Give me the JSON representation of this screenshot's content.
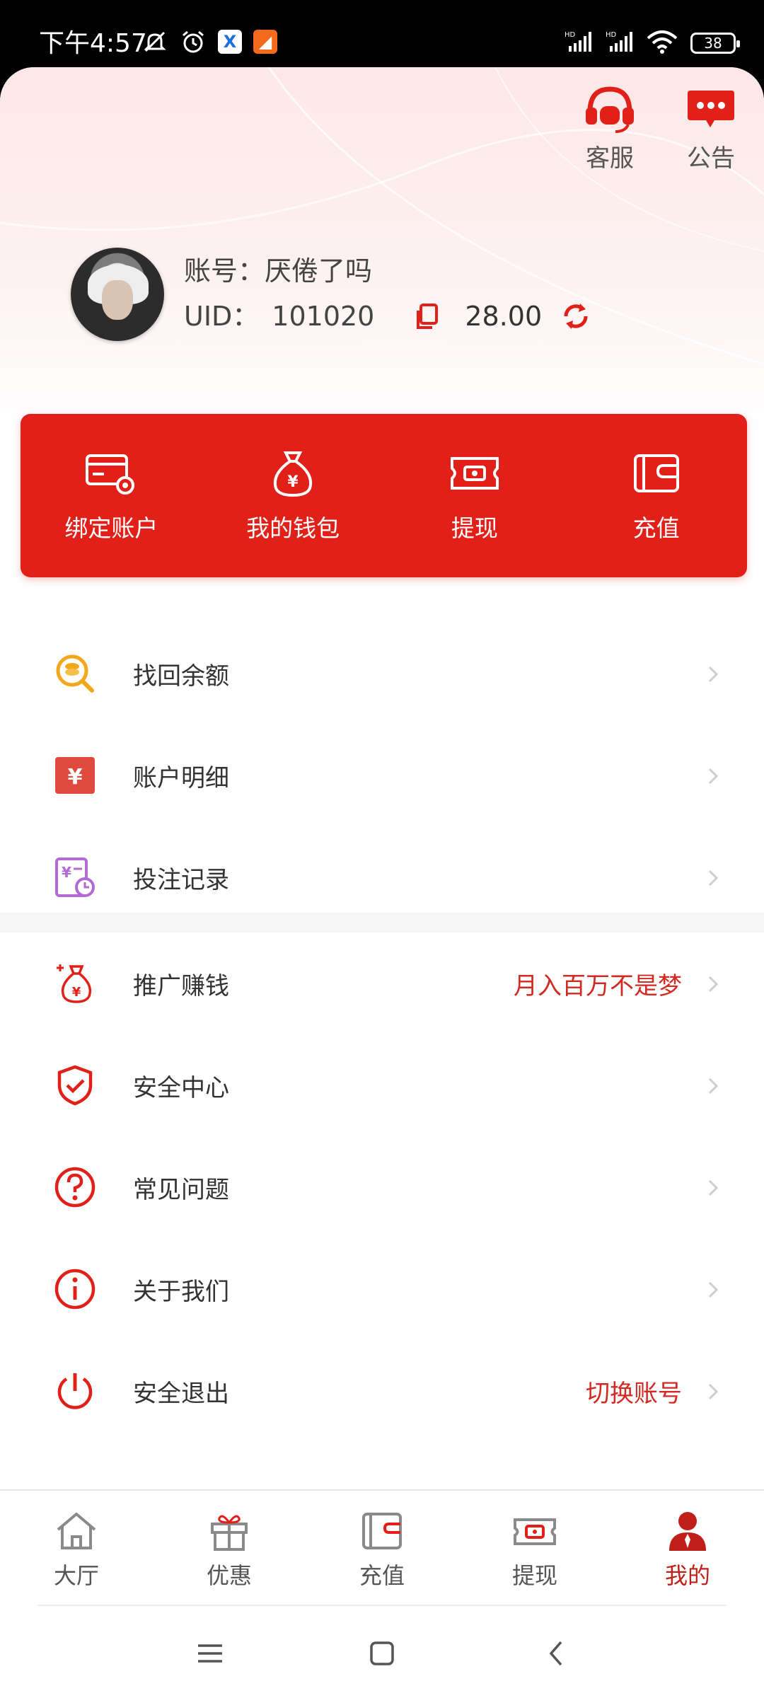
{
  "status_bar": {
    "time": "下午4:57",
    "battery": "38"
  },
  "header": {
    "customer_service_label": "客服",
    "announcement_label": "公告"
  },
  "profile": {
    "account_label": "账号：",
    "account_name": "厌倦了吗",
    "uid_label": "UID：",
    "uid_value": "101020",
    "balance": "28.00"
  },
  "card": {
    "items": [
      {
        "label": "绑定账户",
        "icon": "card-settings-icon"
      },
      {
        "label": "我的钱包",
        "icon": "money-bag-icon"
      },
      {
        "label": "提现",
        "icon": "withdraw-ticket-icon"
      },
      {
        "label": "充值",
        "icon": "wallet-icon"
      }
    ]
  },
  "menu1": [
    {
      "label": "找回余额",
      "icon": "coin-search-icon"
    },
    {
      "label": "账户明细",
      "icon": "yen-document-icon"
    },
    {
      "label": "投注记录",
      "icon": "bet-record-icon"
    }
  ],
  "menu2": [
    {
      "label": "推广赚钱",
      "icon": "promotion-bag-icon",
      "extra": "月入百万不是梦"
    },
    {
      "label": "安全中心",
      "icon": "shield-check-icon"
    },
    {
      "label": "常见问题",
      "icon": "question-icon"
    },
    {
      "label": "关于我们",
      "icon": "info-icon"
    },
    {
      "label": "安全退出",
      "icon": "power-icon",
      "extra": "切换账号"
    }
  ],
  "bottom_nav": [
    {
      "label": "大厅",
      "icon": "home-icon"
    },
    {
      "label": "优惠",
      "icon": "gift-icon"
    },
    {
      "label": "充值",
      "icon": "wallet-icon"
    },
    {
      "label": "提现",
      "icon": "withdraw-ticket-icon"
    },
    {
      "label": "我的",
      "icon": "user-icon",
      "active": true
    }
  ],
  "colors": {
    "brand_red": "#e02019",
    "accent_text": "#d02a22"
  }
}
